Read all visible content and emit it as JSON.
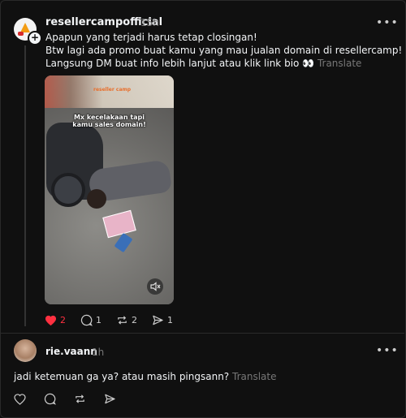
{
  "post": {
    "username": "resellercampofficial",
    "time": "15h",
    "more": "•••",
    "lines": [
      "Apapun yang terjadi harus tetap closingan!",
      "Btw lagi ada promo buat kamu yang mau jualan domain di resellercamp!",
      "Langsung DM buat info lebih lanjut atau klik link bio 👀"
    ],
    "translate": "Translate",
    "media": {
      "caption_line1": "Mx kecelakaan tapi",
      "caption_line2": "kamu sales domain!",
      "brand": "reseller camp"
    },
    "actions": {
      "like_count": "2",
      "comment_count": "1",
      "repost_count": "2",
      "share_count": "1"
    }
  },
  "reply": {
    "username": "rie.vaann",
    "time": "1h",
    "more": "•••",
    "text": "jadi ketemuan ga ya? atau masih pingsann?",
    "translate": "Translate"
  },
  "colors": {
    "background": "#101010",
    "text": "#f3f5f7",
    "muted": "#777777",
    "like": "#ff3040"
  }
}
